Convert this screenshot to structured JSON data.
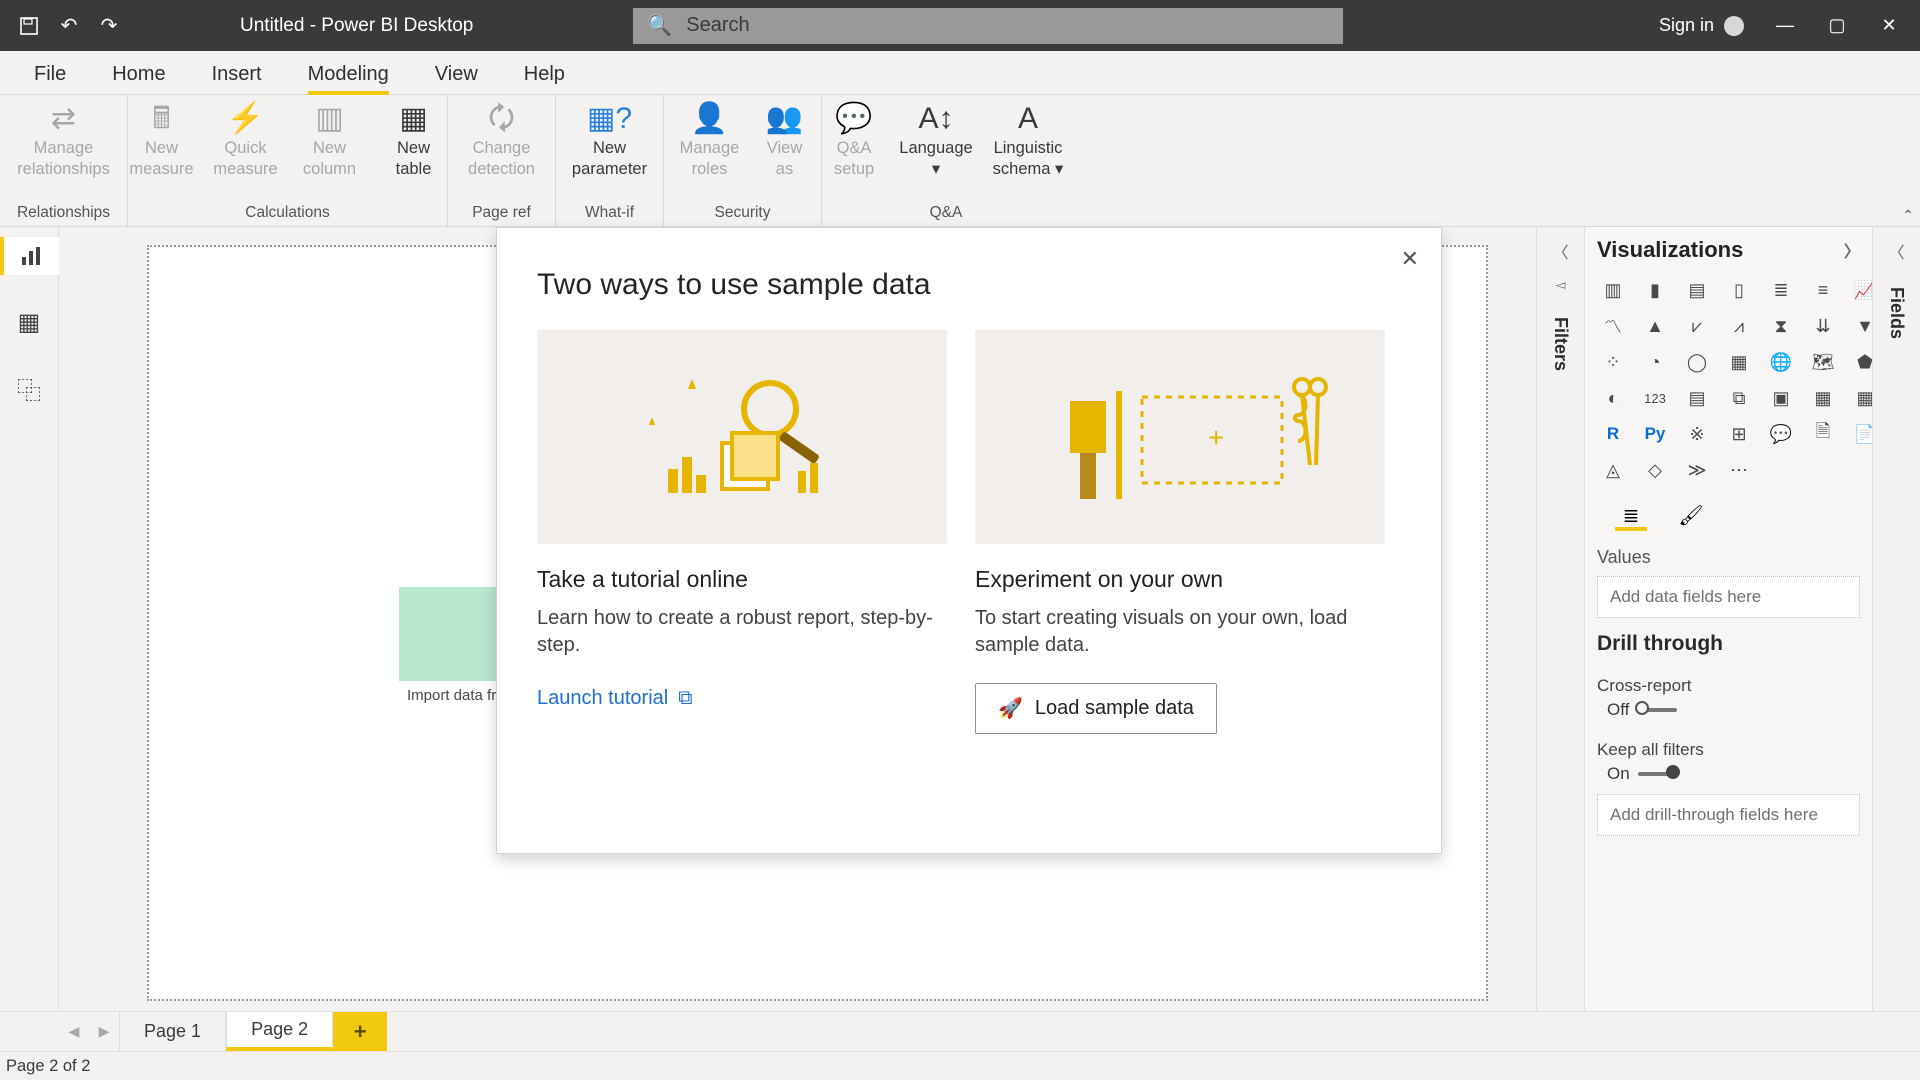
{
  "titlebar": {
    "title": "Untitled - Power BI Desktop",
    "search_placeholder": "Search",
    "signin": "Sign in"
  },
  "menutabs": [
    "File",
    "Home",
    "Insert",
    "Modeling",
    "View",
    "Help"
  ],
  "menu_active_index": 3,
  "ribbon": {
    "groups": [
      {
        "label": "Relationships",
        "items": [
          {
            "l1": "Manage",
            "l2": "relationships",
            "disabled": true
          }
        ]
      },
      {
        "label": "Calculations",
        "items": [
          {
            "l1": "New",
            "l2": "measure",
            "disabled": true
          },
          {
            "l1": "Quick",
            "l2": "measure",
            "disabled": true
          },
          {
            "l1": "New",
            "l2": "column",
            "disabled": true
          },
          {
            "l1": "New",
            "l2": "table",
            "disabled": false
          }
        ]
      },
      {
        "label": "Page ref",
        "items": [
          {
            "l1": "Change",
            "l2": "detection",
            "disabled": true
          }
        ]
      },
      {
        "label": "What-if",
        "items": [
          {
            "l1": "New",
            "l2": "parameter",
            "disabled": false
          }
        ]
      },
      {
        "label": "Security",
        "items": [
          {
            "l1": "Manage",
            "l2": "roles",
            "disabled": true
          },
          {
            "l1": "View",
            "l2": "as",
            "disabled": true
          }
        ]
      },
      {
        "label": "Q&A",
        "items": [
          {
            "l1": "Q&A",
            "l2": "setup",
            "disabled": true
          },
          {
            "l1": "Language",
            "l2": "▾",
            "disabled": false
          },
          {
            "l1": "Linguistic",
            "l2": "schema ▾",
            "disabled": false
          }
        ]
      }
    ]
  },
  "canvas_card_caption": "Import data fro",
  "filters_label": "Filters",
  "fields_label": "Fields",
  "viz": {
    "title": "Visualizations",
    "values_label": "Values",
    "values_placeholder": "Add data fields here",
    "drill_title": "Drill through",
    "cross_report": "Cross-report",
    "off": "Off",
    "keep_filters": "Keep all filters",
    "on": "On",
    "drill_placeholder": "Add drill-through fields here"
  },
  "pages": [
    "Page 1",
    "Page 2"
  ],
  "active_page_index": 1,
  "status": "Page 2 of 2",
  "dialog": {
    "title": "Two ways to use sample data",
    "left": {
      "heading": "Take a tutorial online",
      "body": "Learn how to create a robust report, step-by-step.",
      "link": "Launch tutorial"
    },
    "right": {
      "heading": "Experiment on your own",
      "body": "To start creating visuals on your own, load sample data.",
      "button": "Load sample data"
    }
  }
}
